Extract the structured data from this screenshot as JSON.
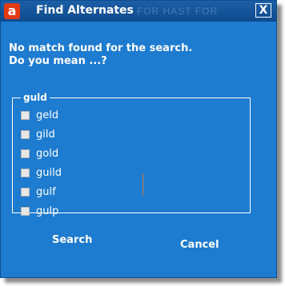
{
  "window": {
    "title": "Find Alternates",
    "app_icon_letter": "a",
    "background_text": "FOR HAST FOR",
    "close_label": "X",
    "accent_color": "#1d7bd0"
  },
  "message": {
    "line1": "No match found for the search.",
    "line2": "Do you mean ...?"
  },
  "group": {
    "label": "guld",
    "options": [
      {
        "label": "geld",
        "checked": false
      },
      {
        "label": "gild",
        "checked": false
      },
      {
        "label": "gold",
        "checked": false
      },
      {
        "label": "guild",
        "checked": false
      },
      {
        "label": "gulf",
        "checked": false
      },
      {
        "label": "gulp",
        "checked": false
      }
    ]
  },
  "buttons": {
    "search": "Search",
    "cancel": "Cancel"
  }
}
